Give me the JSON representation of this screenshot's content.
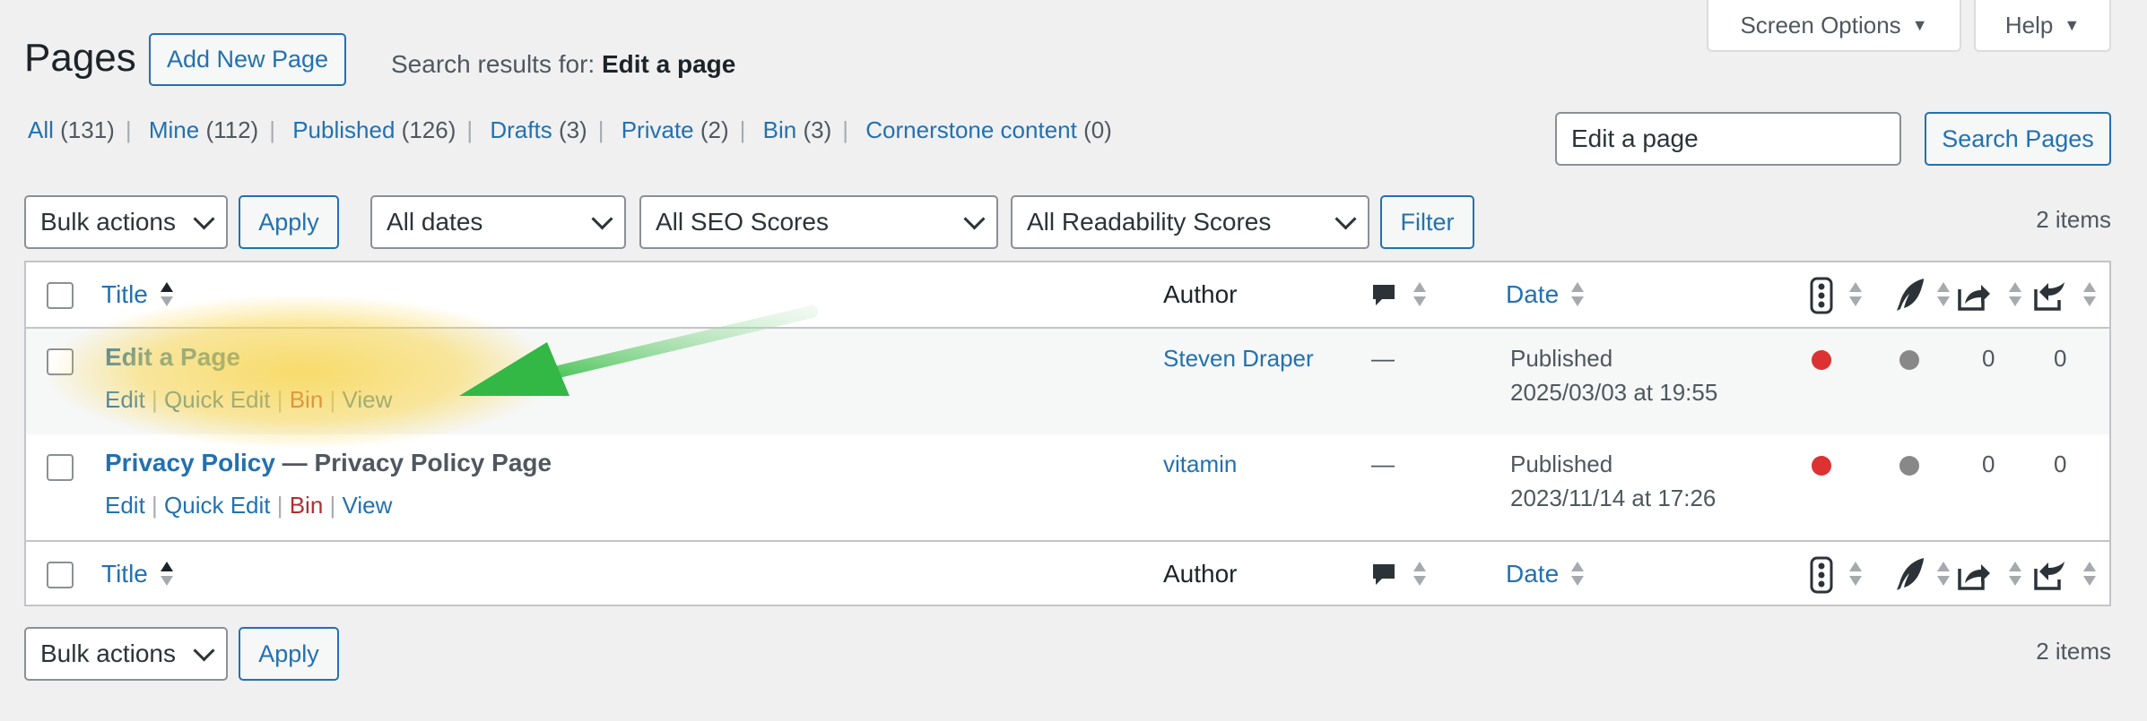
{
  "header": {
    "title": "Pages",
    "add_new_label": "Add New Page",
    "search_results_prefix": "Search results for: ",
    "search_term": "Edit a page",
    "screen_options_label": "Screen Options",
    "help_label": "Help"
  },
  "views": [
    {
      "label": "All",
      "count": "(131)"
    },
    {
      "label": "Mine",
      "count": "(112)"
    },
    {
      "label": "Published",
      "count": "(126)"
    },
    {
      "label": "Drafts",
      "count": "(3)"
    },
    {
      "label": "Private",
      "count": "(2)"
    },
    {
      "label": "Bin",
      "count": "(3)"
    },
    {
      "label": "Cornerstone content",
      "count": " (0)"
    }
  ],
  "search": {
    "value": "Edit a page",
    "button_label": "Search Pages"
  },
  "filters": {
    "bulk_actions": "Bulk actions",
    "apply_label": "Apply",
    "dates": "All dates",
    "seo": "All SEO Scores",
    "readability": "All Readability Scores",
    "filter_label": "Filter",
    "items_count": "2 items"
  },
  "table": {
    "columns": {
      "title": "Title",
      "author": "Author",
      "date": "Date"
    },
    "rows": [
      {
        "title": "Edit a Page",
        "title_suffix": "",
        "actions": {
          "edit": "Edit",
          "quick_edit": "Quick Edit",
          "bin": "Bin",
          "view": "View"
        },
        "author": "Steven Draper",
        "comments": "—",
        "status": "Published",
        "date": "2025/03/03 at 19:55",
        "seo_color": "#dc3232",
        "readability_color": "#888888",
        "links_out": "0",
        "links_in": "0"
      },
      {
        "title": "Privacy Policy",
        "title_suffix": " — Privacy Policy Page",
        "actions": {
          "edit": "Edit",
          "quick_edit": "Quick Edit",
          "bin": "Bin",
          "view": "View"
        },
        "author": "vitamin",
        "comments": "—",
        "status": "Published",
        "date": "2023/11/14 at 17:26",
        "seo_color": "#dc3232",
        "readability_color": "#888888",
        "links_out": "0",
        "links_in": "0"
      }
    ]
  },
  "footer": {
    "bulk_actions": "Bulk actions",
    "apply_label": "Apply",
    "items_count": "2 items"
  },
  "icons": [
    "comment-bubble-icon",
    "seo-traffic-light-icon",
    "readability-quill-icon",
    "outgoing-links-icon",
    "incoming-links-icon",
    "sort-arrows-icon",
    "green-arrow-annotation"
  ]
}
